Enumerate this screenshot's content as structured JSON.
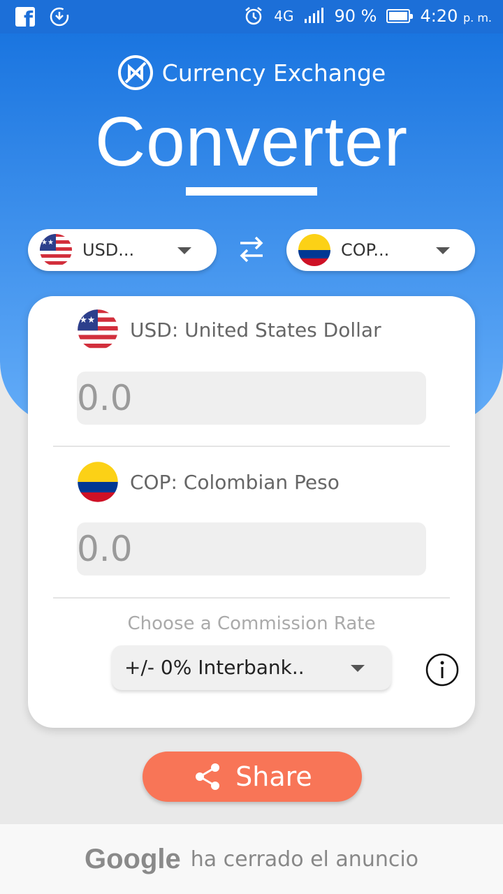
{
  "status_bar": {
    "network": "4G",
    "battery": "90 %",
    "time": "4:20",
    "ampm": "p. m."
  },
  "header": {
    "brand": "Currency Exchange",
    "title": "Converter"
  },
  "selectors": {
    "from_code": "USD...",
    "to_code": "COP..."
  },
  "converter": {
    "from": {
      "name": "USD: United States Dollar",
      "value": "0.0"
    },
    "to": {
      "name": "COP: Colombian Peso",
      "value": "0.0"
    },
    "commission_label": "Choose a Commission Rate",
    "commission_value": "+/- 0% Interbank.."
  },
  "share": {
    "label": "Share"
  },
  "ad": {
    "brand": "Google",
    "message": "ha cerrado el anuncio"
  },
  "colors": {
    "accent_blue": "#1a75e0",
    "share_orange": "#f87557"
  }
}
